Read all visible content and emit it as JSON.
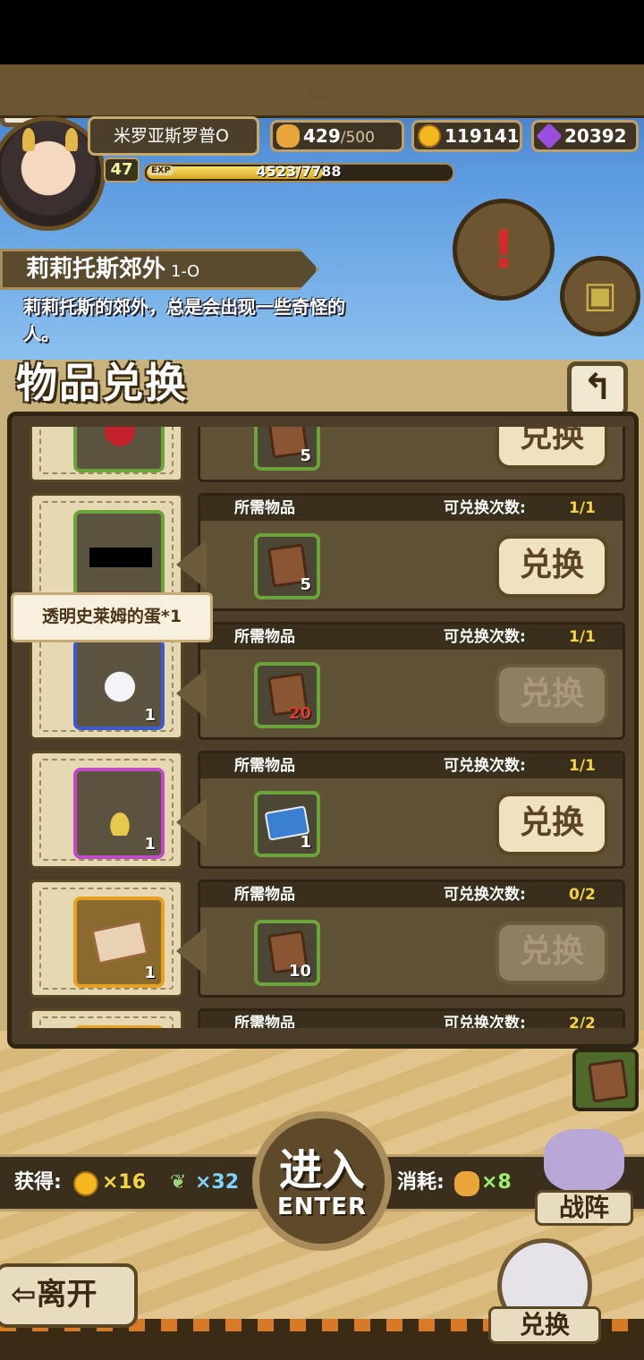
{
  "player": {
    "name": "米罗亚斯罗普O",
    "level": "47",
    "exp_tag": "EXP",
    "exp_text": "4523/7788",
    "exp_fraction": 0.58
  },
  "resources": {
    "bread_current": "429",
    "bread_max": "/500",
    "gold": "119141",
    "gems": "20392"
  },
  "stage": {
    "name": "莉莉托斯郊外",
    "code": "1-O",
    "description": "莉莉托斯的郊外，总是会出现一些奇怪的人。"
  },
  "panel": {
    "title": "物品兑换",
    "back_symbol": "↰"
  },
  "rows_common": {
    "required_label": "所需物品",
    "count_label": "可兑换次数:",
    "exchange_label": "兑换"
  },
  "rows": [
    {
      "req_qty": "5",
      "count": "",
      "enabled": true
    },
    {
      "req_qty": "5",
      "count": "1/1",
      "enabled": true
    },
    {
      "reward_qty": "1",
      "req_qty": "20",
      "count": "1/1",
      "enabled": false
    },
    {
      "reward_qty": "1",
      "req_qty": "1",
      "count": "1/1",
      "enabled": true
    },
    {
      "reward_qty": "1",
      "req_qty": "10",
      "count": "0/2",
      "enabled": false
    },
    {
      "count": "2/2",
      "enabled": true
    }
  ],
  "tooltip": "透明史莱姆的蛋*1",
  "hud": {
    "gain_label": "获得:",
    "gold_gain": "×16",
    "feather_gain": "×32",
    "cost_label": "消耗:",
    "bread_cost": "×8",
    "enter_cn": "进入",
    "enter_en": "ENTER",
    "formation": "战阵",
    "leave": "⇦离开",
    "exchange": "兑换"
  },
  "colors": {
    "accent_gold": "#f5d440",
    "panel_bg": "#4b3d27",
    "button_bg": "#efe2bf"
  }
}
